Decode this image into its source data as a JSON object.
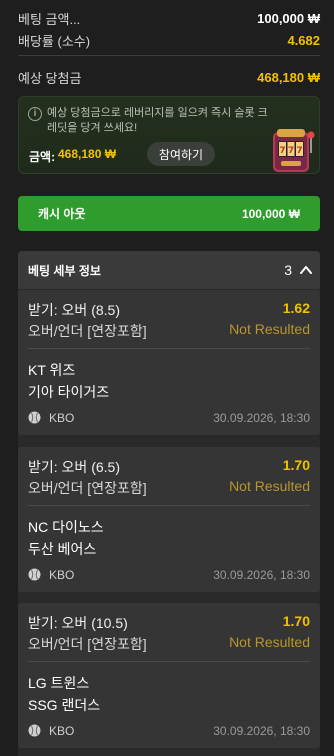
{
  "summary": {
    "stake_label": "베팅 금액...",
    "stake_value": "100,000 ₩",
    "odds_label": "배당률 (소수)",
    "odds_value": "4.682",
    "payout_label": "예상 당첨금",
    "payout_value": "468,180 ₩"
  },
  "promo": {
    "message": "예상 당첨금으로 레버리지를 일으켜 즉시 슬롯 크레딧을 당겨 쓰세요!",
    "amount_label": "금액:",
    "amount_value": "468,180 ₩",
    "join_button": "참여하기",
    "image_icon": "slot-machine-icon"
  },
  "cashout": {
    "label": "캐시 아웃",
    "value": "100,000 ₩",
    "color": "#2e9d2d"
  },
  "details": {
    "title": "베팅 세부 정보",
    "count": "3"
  },
  "bets": [
    {
      "market": "받기: 오버 (8.5)",
      "odds": "1.62",
      "type": "오버/언더 [연장포함]",
      "status": "Not Resulted",
      "team1": "KT 위즈",
      "team2": "기아 타이거즈",
      "league": "KBO",
      "date": "30.09.2026, 18:30"
    },
    {
      "market": "받기: 오버 (6.5)",
      "odds": "1.70",
      "type": "오버/언더 [연장포함]",
      "status": "Not Resulted",
      "team1": "NC 다이노스",
      "team2": "두산 베어스",
      "league": "KBO",
      "date": "30.09.2026, 18:30"
    },
    {
      "market": "받기: 오버 (10.5)",
      "odds": "1.70",
      "type": "오버/언더 [연장포함]",
      "status": "Not Resulted",
      "team1": "LG 트윈스",
      "team2": "SSG 랜더스",
      "league": "KBO",
      "date": "30.09.2026, 18:30"
    }
  ],
  "colors": {
    "accent_gold": "#f2c200",
    "cashout_green": "#2e9d2d",
    "background": "#1e1e1e"
  }
}
